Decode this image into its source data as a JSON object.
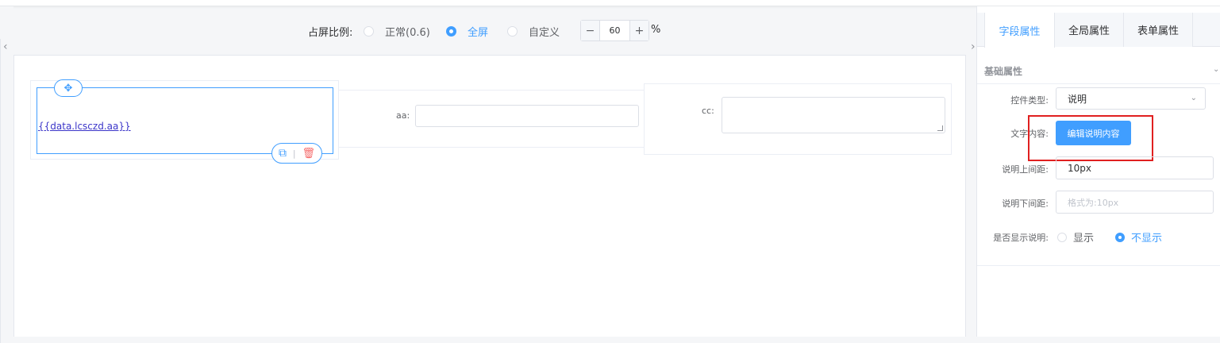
{
  "toolbar": {
    "ratio_label": "占屏比例:",
    "options": [
      {
        "label": "正常(0.6)",
        "checked": false
      },
      {
        "label": "全屏",
        "checked": true
      },
      {
        "label": "自定义",
        "checked": false
      }
    ],
    "stepper": {
      "minus": "−",
      "value": "60",
      "plus": "+"
    },
    "percent": "%"
  },
  "canvas": {
    "description_field": {
      "text": "{{data.lcsczd.aa}}"
    },
    "field_aa": {
      "label": "aa:",
      "value": ""
    },
    "field_cc": {
      "label": "cc:",
      "value": ""
    }
  },
  "panel": {
    "tabs": [
      "字段属性",
      "全局属性",
      "表单属性"
    ],
    "active_tab": "字段属性",
    "section_title": "基础属性",
    "control_type": {
      "label": "控件类型:",
      "value": "说明"
    },
    "text_content": {
      "label": "文字内容:",
      "button": "编辑说明内容"
    },
    "top_spacing": {
      "label": "说明上间距:",
      "value": "10px"
    },
    "bottom_spacing": {
      "label": "说明下间距:",
      "placeholder": "格式为:10px"
    },
    "show_desc": {
      "label": "是否显示说明:",
      "options": [
        {
          "label": "显示",
          "checked": false
        },
        {
          "label": "不显示",
          "checked": true
        }
      ]
    }
  },
  "colors": {
    "accent": "#409eff",
    "highlight": "#e02020",
    "danger": "#f56c6c"
  },
  "icons": [
    "move-icon",
    "copy-icon",
    "delete-icon",
    "chevron-down-icon",
    "collapse-left-icon",
    "collapse-right-icon"
  ]
}
